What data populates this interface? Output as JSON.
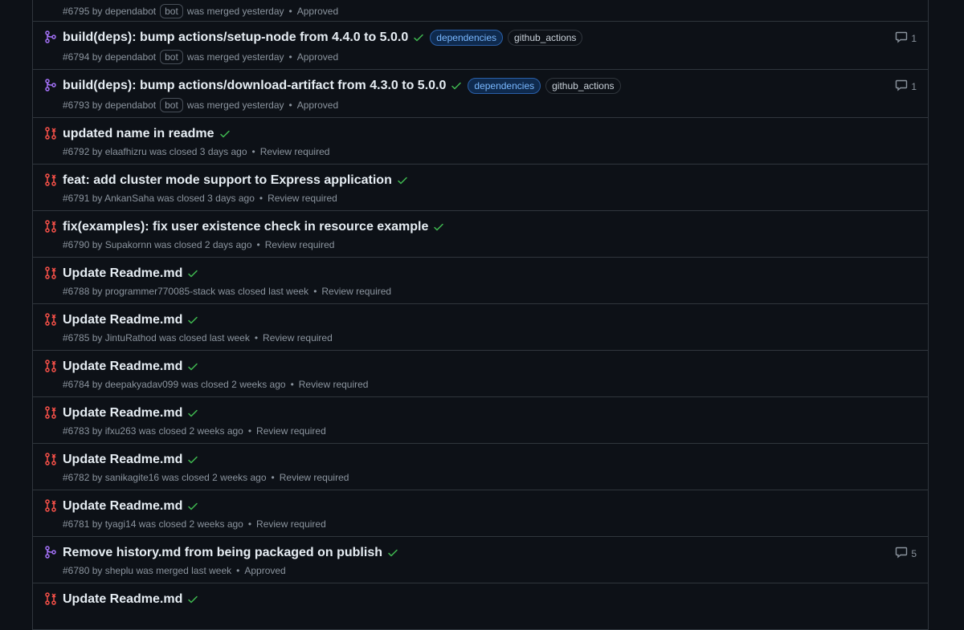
{
  "colors": {
    "merged": "#a371f7",
    "closed": "#f85149",
    "check": "#3fb950",
    "muted": "#8b949e"
  },
  "prs": [
    {
      "state": "merged",
      "title": "",
      "number": "#6795",
      "by": "by dependabot",
      "bot": "bot",
      "status": "was merged yesterday",
      "review": "Approved",
      "labels": [],
      "comments": ""
    },
    {
      "state": "merged",
      "title": "build(deps): bump actions/setup-node from 4.4.0 to 5.0.0",
      "number": "#6794",
      "by": "by dependabot",
      "bot": "bot",
      "status": "was merged yesterday",
      "review": "Approved",
      "labels": [
        "dependencies",
        "github_actions"
      ],
      "comments": "1"
    },
    {
      "state": "merged",
      "title": "build(deps): bump actions/download-artifact from 4.3.0 to 5.0.0",
      "number": "#6793",
      "by": "by dependabot",
      "bot": "bot",
      "status": "was merged yesterday",
      "review": "Approved",
      "labels": [
        "dependencies",
        "github_actions"
      ],
      "comments": "1"
    },
    {
      "state": "closed",
      "title": "updated name in readme",
      "number": "#6792",
      "by": "by elaafhizru",
      "bot": "",
      "status": "was closed 3 days ago",
      "review": "Review required",
      "labels": [],
      "comments": ""
    },
    {
      "state": "closed",
      "title": "feat: add cluster mode support to Express application",
      "number": "#6791",
      "by": "by AnkanSaha",
      "bot": "",
      "status": "was closed 3 days ago",
      "review": "Review required",
      "labels": [],
      "comments": ""
    },
    {
      "state": "closed",
      "title": "fix(examples): fix user existence check in resource example",
      "number": "#6790",
      "by": "by Supakornn",
      "bot": "",
      "status": "was closed 2 days ago",
      "review": "Review required",
      "labels": [],
      "comments": ""
    },
    {
      "state": "closed",
      "title": "Update Readme.md",
      "number": "#6788",
      "by": "by programmer770085-stack",
      "bot": "",
      "status": "was closed last week",
      "review": "Review required",
      "labels": [],
      "comments": ""
    },
    {
      "state": "closed",
      "title": "Update Readme.md",
      "number": "#6785",
      "by": "by JintuRathod",
      "bot": "",
      "status": "was closed last week",
      "review": "Review required",
      "labels": [],
      "comments": ""
    },
    {
      "state": "closed",
      "title": "Update Readme.md",
      "number": "#6784",
      "by": "by deepakyadav099",
      "bot": "",
      "status": "was closed 2 weeks ago",
      "review": "Review required",
      "labels": [],
      "comments": ""
    },
    {
      "state": "closed",
      "title": "Update Readme.md",
      "number": "#6783",
      "by": "by ifxu263",
      "bot": "",
      "status": "was closed 2 weeks ago",
      "review": "Review required",
      "labels": [],
      "comments": ""
    },
    {
      "state": "closed",
      "title": "Update Readme.md",
      "number": "#6782",
      "by": "by sanikagite16",
      "bot": "",
      "status": "was closed 2 weeks ago",
      "review": "Review required",
      "labels": [],
      "comments": ""
    },
    {
      "state": "closed",
      "title": "Update Readme.md",
      "number": "#6781",
      "by": "by tyagi14",
      "bot": "",
      "status": "was closed 2 weeks ago",
      "review": "Review required",
      "labels": [],
      "comments": ""
    },
    {
      "state": "merged",
      "title": "Remove history.md from being packaged on publish",
      "number": "#6780",
      "by": "by sheplu",
      "bot": "",
      "status": "was merged last week",
      "review": "Approved",
      "labels": [],
      "comments": "5"
    },
    {
      "state": "closed",
      "title": "Update Readme.md",
      "number": "",
      "by": "",
      "bot": "",
      "status": "",
      "review": "",
      "labels": [],
      "comments": ""
    }
  ]
}
